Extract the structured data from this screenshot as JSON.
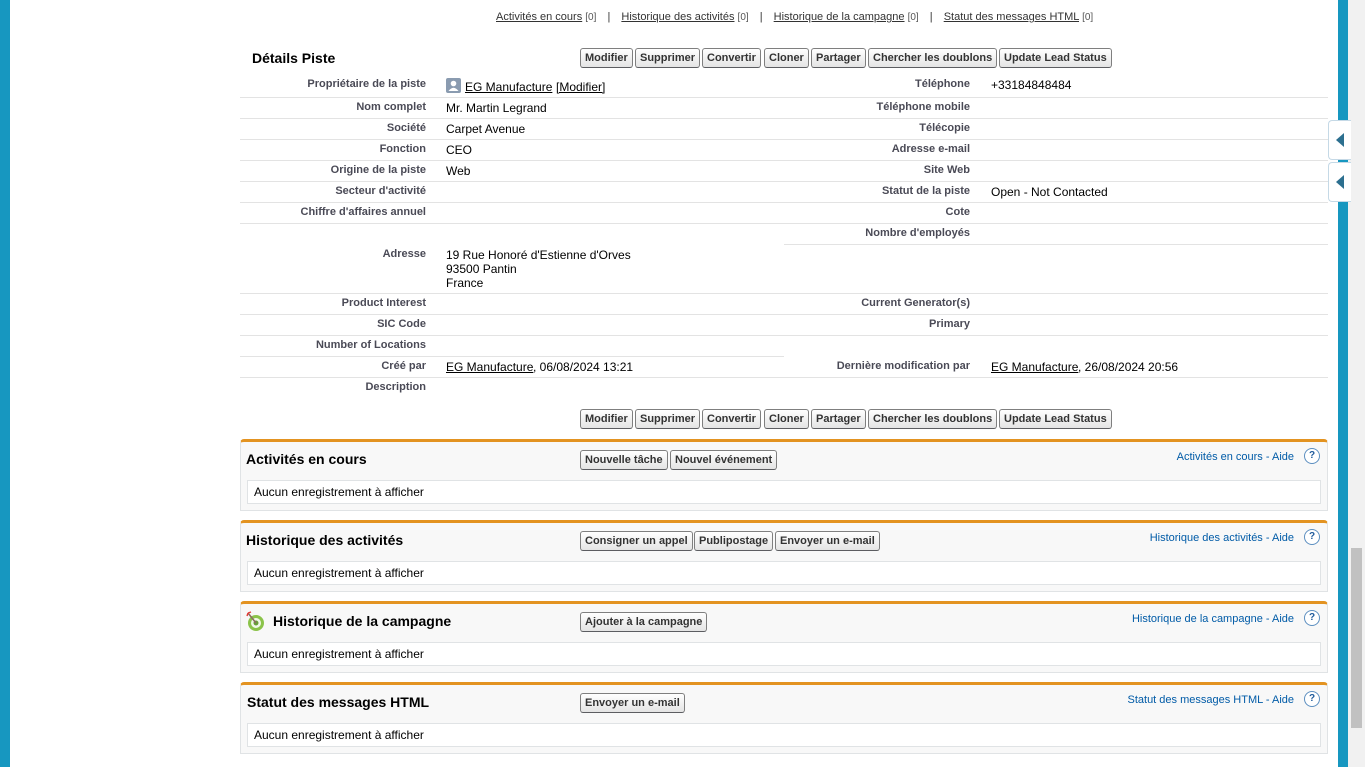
{
  "top_links": [
    {
      "label": "Activités en cours",
      "count": "[0]"
    },
    {
      "label": "Historique des activités",
      "count": "[0]"
    },
    {
      "label": "Historique de la campagne",
      "count": "[0]"
    },
    {
      "label": "Statut des messages HTML",
      "count": "[0]"
    }
  ],
  "details": {
    "title": "Détails Piste",
    "buttons": [
      "Modifier",
      "Supprimer",
      "Convertir",
      "Cloner",
      "Partager",
      "Chercher les doublons",
      "Update Lead Status"
    ],
    "left_fields": [
      {
        "label": "Propriétaire de la piste",
        "value": "EG Manufacture",
        "extra": "[Modifier]"
      },
      {
        "label": "Nom complet",
        "value": "Mr. Martin Legrand"
      },
      {
        "label": "Société",
        "value": "Carpet Avenue"
      },
      {
        "label": "Fonction",
        "value": "CEO"
      },
      {
        "label": "Origine de la piste",
        "value": "Web"
      },
      {
        "label": "Secteur d'activité",
        "value": ""
      },
      {
        "label": "Chiffre d'affaires annuel",
        "value": ""
      },
      {
        "label": "Adresse",
        "value": "19 Rue Honoré d'Estienne d'Orves",
        "value2": "93500 Pantin",
        "value3": "France"
      },
      {
        "label": "Product Interest",
        "value": ""
      },
      {
        "label": "SIC Code",
        "value": ""
      },
      {
        "label": "Number of Locations",
        "value": ""
      },
      {
        "label": "Créé par",
        "value": "EG Manufacture",
        "date": ", 06/08/2024 13:21"
      },
      {
        "label": "Description",
        "value": ""
      }
    ],
    "right_fields": [
      {
        "label": "Téléphone",
        "value": "+33184848484"
      },
      {
        "label": "Téléphone mobile",
        "value": ""
      },
      {
        "label": "Télécopie",
        "value": ""
      },
      {
        "label": "Adresse e-mail",
        "value": ""
      },
      {
        "label": "Site Web",
        "value": ""
      },
      {
        "label": "Statut de la piste",
        "value": "Open - Not Contacted"
      },
      {
        "label": "Cote",
        "value": ""
      },
      {
        "label": "Nombre d'employés",
        "value": ""
      },
      {
        "label": "Current Generator(s)",
        "value": ""
      },
      {
        "label": "Primary",
        "value": ""
      },
      {
        "label": "Dernière modification par",
        "value": "EG Manufacture",
        "date": ", 26/08/2024 20:56"
      }
    ]
  },
  "panels": [
    {
      "title": "Activités en cours",
      "buttons": [
        "Nouvelle tâche",
        "Nouvel événement"
      ],
      "help": "Activités en cours - Aide",
      "empty": "Aucun enregistrement à afficher"
    },
    {
      "title": "Historique des activités",
      "buttons": [
        "Consigner un appel",
        "Publipostage",
        "Envoyer un e-mail"
      ],
      "help": "Historique des activités - Aide",
      "empty": "Aucun enregistrement à afficher"
    },
    {
      "title": "Historique de la campagne",
      "buttons": [
        "Ajouter à la  campagne"
      ],
      "help": "Historique de la campagne - Aide",
      "empty": "Aucun enregistrement à afficher"
    },
    {
      "title": "Statut des messages HTML",
      "buttons": [
        "Envoyer un e-mail"
      ],
      "help": "Statut des messages HTML - Aide",
      "empty": "Aucun enregistrement à afficher"
    }
  ],
  "help_glyph": "?",
  "colors": {
    "accent": "#1797c0",
    "panel_border": "#e39321",
    "link": "#015ba7"
  }
}
